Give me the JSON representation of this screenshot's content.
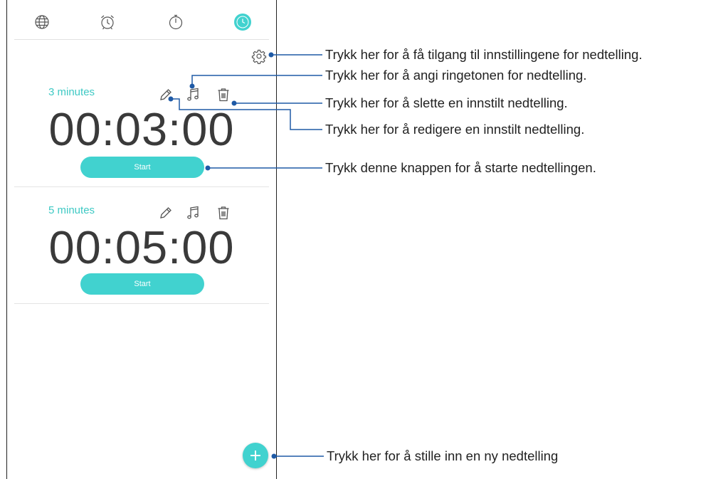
{
  "colors": {
    "accent": "#41d2cf",
    "label": "#3ec9c4",
    "leader": "#1f5aa6"
  },
  "tabs": [
    {
      "icon": "globe-icon",
      "label": "World clock"
    },
    {
      "icon": "alarm-clock-icon",
      "label": "Alarm"
    },
    {
      "icon": "stopwatch-icon",
      "label": "Stopwatch"
    },
    {
      "icon": "timer-icon",
      "label": "Timer",
      "active": true
    }
  ],
  "timers": [
    {
      "label": "3 minutes",
      "time": "00:03:00",
      "start_label": "Start"
    },
    {
      "label": "5 minutes",
      "time": "00:05:00",
      "start_label": "Start"
    }
  ],
  "callouts": {
    "settings": "Trykk her for å få tilgang til innstillingene for nedtelling.",
    "ringtone": "Trykk her for å angi ringetonen for nedtelling.",
    "delete": "Trykk her for å slette en innstilt nedtelling.",
    "edit": "Trykk her for å redigere en innstilt nedtelling.",
    "start": "Trykk denne knappen for å starte nedtellingen.",
    "add": "Trykk her for å stille inn en ny nedtelling"
  }
}
